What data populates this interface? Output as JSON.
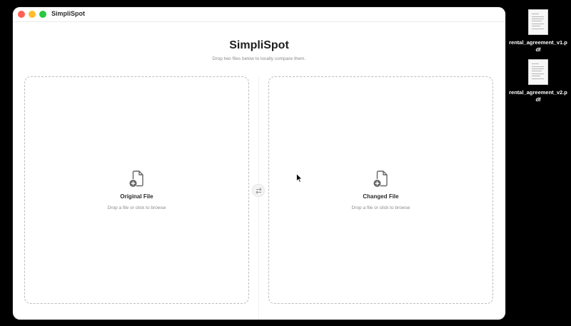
{
  "window": {
    "title": "SimpliSpot"
  },
  "app": {
    "title": "SimpliSpot",
    "subtitle": "Drop two files below to locally compare them."
  },
  "dropzones": {
    "original": {
      "label": "Original File",
      "hint": "Drop a file or click to browse",
      "icon": "file-plus-icon"
    },
    "changed": {
      "label": "Changed File",
      "hint": "Drop a file or click to browse",
      "icon": "file-plus-icon"
    }
  },
  "swap": {
    "icon": "swap-arrows-icon"
  },
  "desktop": {
    "files": [
      {
        "name": "rental_agreement_v1.pdf"
      },
      {
        "name": "rental_agreement_v2.pdf"
      }
    ]
  },
  "colors": {
    "close": "#ff5f57",
    "minimize": "#febc2e",
    "maximize": "#28c840",
    "desktop_bg": "#000000"
  }
}
